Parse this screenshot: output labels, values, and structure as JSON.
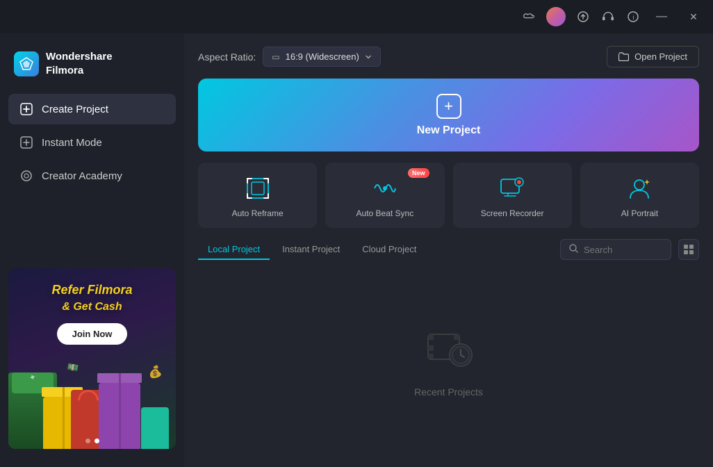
{
  "titlebar": {
    "icons": {
      "cloud": "☁",
      "avatar_gradient": "gradient",
      "upload": "⬆",
      "headset": "🎧",
      "info": "ℹ",
      "minimize": "—",
      "close": "✕"
    }
  },
  "sidebar": {
    "logo": {
      "app_name": "Wondershare\nFilmora",
      "line1": "Wondershare",
      "line2": "Filmora"
    },
    "nav_items": [
      {
        "id": "create-project",
        "label": "Create Project",
        "icon": "⊞",
        "active": true
      },
      {
        "id": "instant-mode",
        "label": "Instant Mode",
        "icon": "⊞",
        "active": false
      },
      {
        "id": "creator-academy",
        "label": "Creator Academy",
        "icon": "◎",
        "active": false
      }
    ],
    "banner": {
      "line1": "Refer Filmora",
      "line2": "& Get Cash",
      "btn_label": "Join Now",
      "dot1": "",
      "dot2": ""
    }
  },
  "main": {
    "aspect_ratio": {
      "label": "Aspect Ratio:",
      "value": "16:9 (Widescreen)",
      "icon": "▭"
    },
    "open_project_btn": "Open Project",
    "new_project": {
      "label": "New Project"
    },
    "tool_cards": [
      {
        "id": "auto-reframe",
        "label": "Auto Reframe",
        "icon_type": "reframe"
      },
      {
        "id": "auto-beat-sync",
        "label": "Auto Beat Sync",
        "icon_type": "beatsync",
        "badge": "New"
      },
      {
        "id": "screen-recorder",
        "label": "Screen Recorder",
        "icon_type": "screenrecord"
      },
      {
        "id": "ai-portrait",
        "label": "AI Portrait",
        "icon_type": "aiportrait"
      }
    ],
    "project_tabs": [
      {
        "id": "local",
        "label": "Local Project",
        "active": true
      },
      {
        "id": "instant",
        "label": "Instant Project",
        "active": false
      },
      {
        "id": "cloud",
        "label": "Cloud Project",
        "active": false
      }
    ],
    "search": {
      "placeholder": "Search"
    },
    "empty_state": {
      "label": "Recent Projects"
    }
  }
}
